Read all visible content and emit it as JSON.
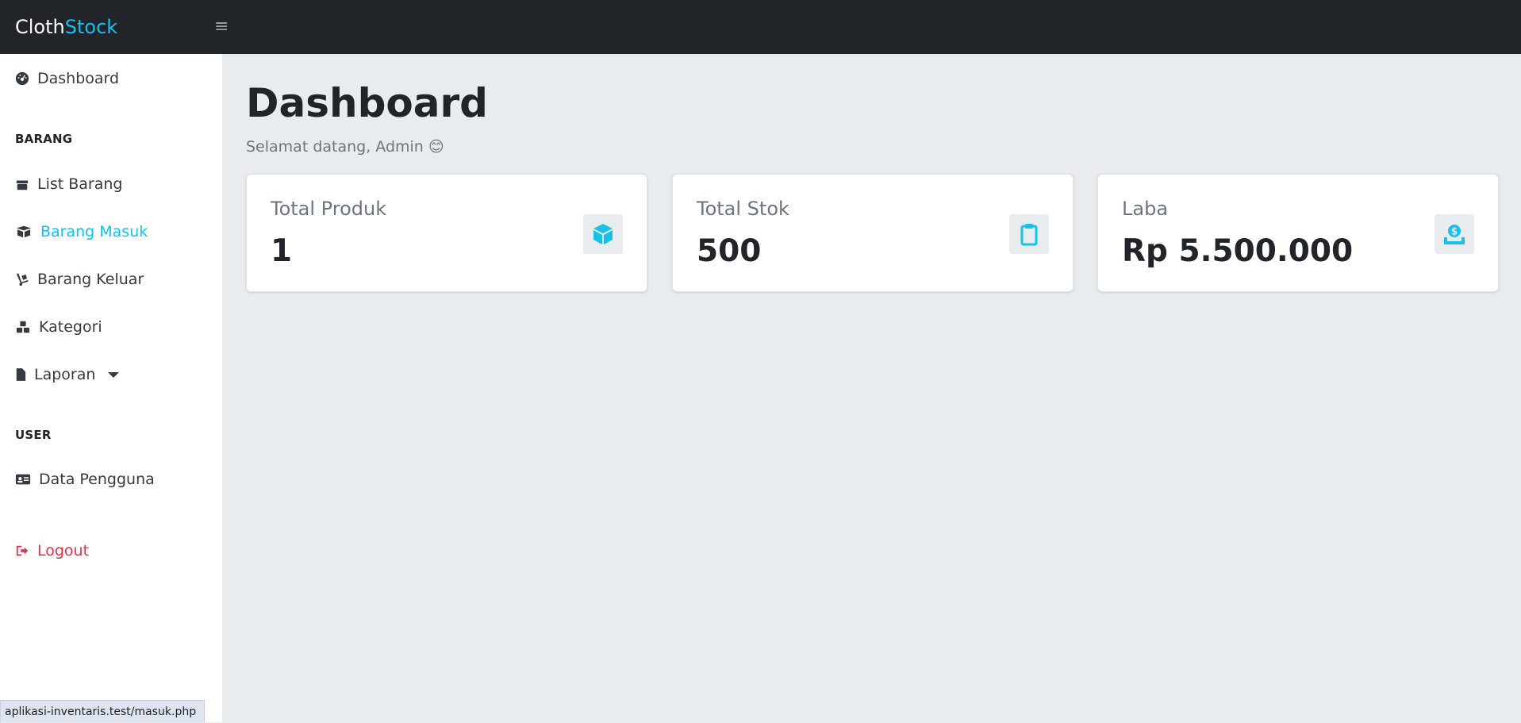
{
  "brand": {
    "part1": "Cloth",
    "part2": "Stock"
  },
  "sidebar": {
    "dashboard": "Dashboard",
    "section_barang": "BARANG",
    "list_barang": "List Barang",
    "barang_masuk": "Barang Masuk",
    "barang_keluar": "Barang Keluar",
    "kategori": "Kategori",
    "laporan": "Laporan",
    "section_user": "USER",
    "data_pengguna": "Data Pengguna",
    "logout": "Logout"
  },
  "main": {
    "title": "Dashboard",
    "welcome": "Selamat datang, Admin 😊"
  },
  "cards": [
    {
      "label": "Total Produk",
      "value": "1",
      "icon": "box-icon"
    },
    {
      "label": "Total Stok",
      "value": "500",
      "icon": "clipboard-icon"
    },
    {
      "label": "Laba",
      "value": "Rp 5.500.000",
      "icon": "money-icon"
    }
  ],
  "status_bar": {
    "url": "aplikasi-inventaris.test/masuk.php"
  },
  "colors": {
    "accent": "#17c1e8",
    "danger": "#dc3545",
    "topbar": "#212529",
    "background": "#e9ecef"
  }
}
